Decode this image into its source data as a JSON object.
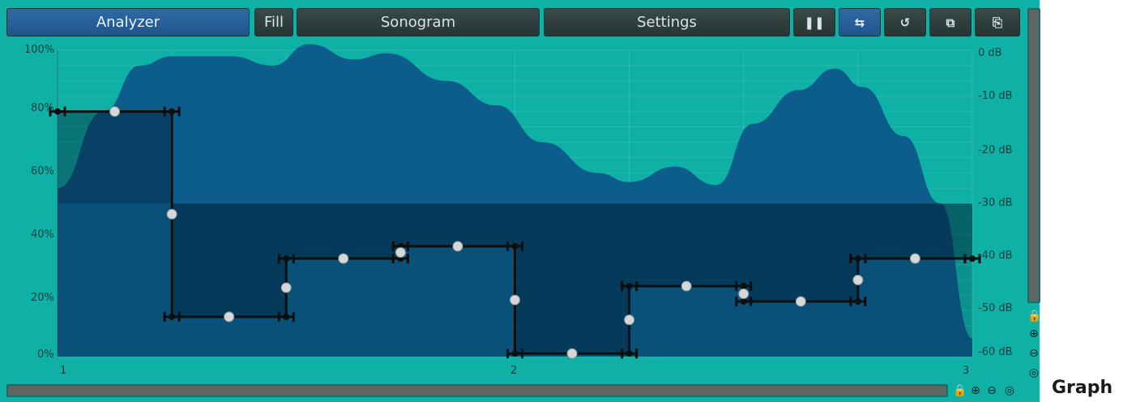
{
  "toolbar": {
    "analyzer_label": "Analyzer",
    "fill_label": "Fill",
    "sonogram_label": "Sonogram",
    "settings_label": "Settings",
    "icons": [
      "pause-icon",
      "freeze-icon",
      "reset-icon",
      "copy-icon",
      "paste-icon"
    ],
    "pause_glyph": "❚❚",
    "freeze_glyph": "⇆",
    "reset_glyph": "↺",
    "copy_glyph": "⧉",
    "paste_glyph": "⎘"
  },
  "graph": {
    "y_labels": [
      "100%",
      "80%",
      "60%",
      "40%",
      "20%",
      "0%"
    ],
    "db_labels": [
      "0 dB",
      "-10 dB",
      "-20 dB",
      "-30 dB",
      "-40 dB",
      "-50 dB",
      "-60 dB"
    ],
    "x_labels": [
      "1",
      "2",
      "3"
    ]
  },
  "sequence": {
    "x_range": [
      1,
      3
    ],
    "y_range_percent": [
      0,
      100
    ],
    "steps": [
      {
        "from": 1.0,
        "to": 1.25,
        "value": 80
      },
      {
        "from": 1.25,
        "to": 1.5,
        "value": 13
      },
      {
        "from": 1.5,
        "to": 1.75,
        "value": 32
      },
      {
        "from": 1.75,
        "to": 2.0,
        "value": 36
      },
      {
        "from": 2.0,
        "to": 2.25,
        "value": 1
      },
      {
        "from": 2.25,
        "to": 2.5,
        "value": 23
      },
      {
        "from": 2.5,
        "to": 2.75,
        "value": 18
      },
      {
        "from": 2.75,
        "to": 3.0,
        "value": 32
      }
    ],
    "midline_percent": 50
  },
  "spectrum_envelope_percent": [
    [
      1.0,
      55
    ],
    [
      1.1,
      80
    ],
    [
      1.18,
      95
    ],
    [
      1.25,
      98
    ],
    [
      1.38,
      98
    ],
    [
      1.47,
      95
    ],
    [
      1.55,
      102
    ],
    [
      1.65,
      97
    ],
    [
      1.72,
      99
    ],
    [
      1.85,
      90
    ],
    [
      1.96,
      82
    ],
    [
      2.06,
      70
    ],
    [
      2.18,
      60
    ],
    [
      2.25,
      57
    ],
    [
      2.35,
      62
    ],
    [
      2.44,
      56
    ],
    [
      2.52,
      76
    ],
    [
      2.62,
      87
    ],
    [
      2.7,
      94
    ],
    [
      2.76,
      88
    ],
    [
      2.85,
      72
    ],
    [
      2.93,
      50
    ],
    [
      3.0,
      6
    ]
  ],
  "controls": {
    "vscroll_lock_glyph": "🔒",
    "zoom_in_glyph": "⊕",
    "zoom_out_glyph": "⊖",
    "zoom_reset_glyph": "◎"
  },
  "heading": "Graph",
  "colors": {
    "background": "#0fb0a6",
    "spectrum": "#0c5a8a",
    "active_button": "#2f6aa5"
  }
}
